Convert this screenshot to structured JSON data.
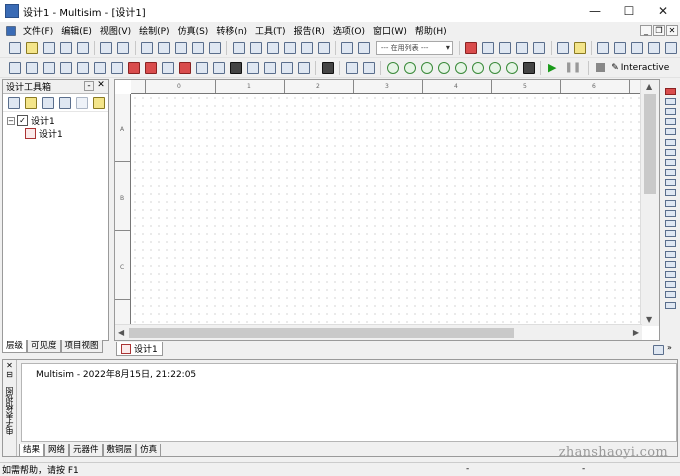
{
  "window": {
    "title": "设计1 - Multisim - [设计1]",
    "minimize": "—",
    "maximize": "☐",
    "close": "✕"
  },
  "menu": [
    "文件(F)",
    "编辑(E)",
    "视图(V)",
    "绘制(P)",
    "仿真(S)",
    "转移(n)",
    "工具(T)",
    "报告(R)",
    "选项(O)",
    "窗口(W)",
    "帮助(H)"
  ],
  "toolbar": {
    "in_use_list": "--- 在用列表 ---",
    "interactive_label": "Interactive"
  },
  "design_toolbox": {
    "title": "设计工具箱",
    "pin": "-",
    "close": "✕",
    "tree": {
      "root": "设计1",
      "child": "设计1"
    },
    "tabs": [
      "层级",
      "可见度",
      "项目视图"
    ]
  },
  "canvas": {
    "col_labels": [
      "0",
      "1",
      "2",
      "3",
      "4",
      "5",
      "6"
    ],
    "row_labels": [
      "A",
      "B",
      "C"
    ],
    "tab": "设计1"
  },
  "output": {
    "side_label": "电子表格视图",
    "close": "✕",
    "message": "Multisim  -  2022年8月15日, 21:22:05",
    "tabs": [
      "结果",
      "网络",
      "元器件",
      "敷铜层",
      "仿真"
    ]
  },
  "status": {
    "text": "如需帮助，请按 F1",
    "dash1": "-",
    "dash2": "-"
  },
  "watermark": "zhanshaoyi.com"
}
